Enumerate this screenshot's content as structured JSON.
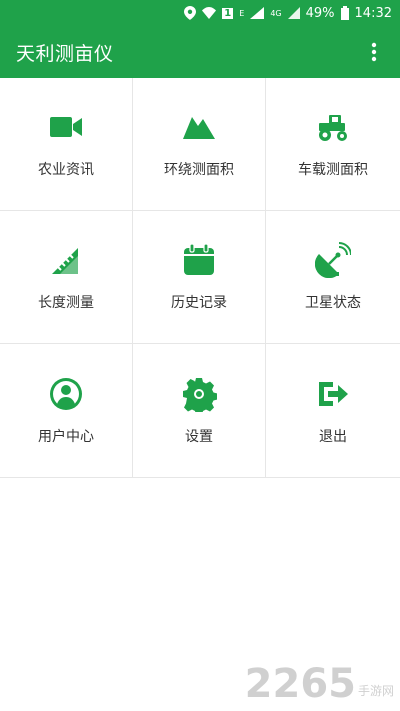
{
  "status_bar": {
    "battery": "49%",
    "time": "14:32",
    "net_label": "E",
    "net_label_2": "4G",
    "sim_badge": "1"
  },
  "app_bar": {
    "title": "天利测亩仪",
    "menu_icon": "more-vert-icon"
  },
  "colors": {
    "brand": "#1fa24a",
    "icon": "#1fa24a"
  },
  "menu": [
    {
      "label": "农业资讯",
      "icon": "video-camera-icon"
    },
    {
      "label": "环绕测面积",
      "icon": "mountain-icon"
    },
    {
      "label": "车载测面积",
      "icon": "tractor-icon"
    },
    {
      "label": "长度测量",
      "icon": "ruler-icon"
    },
    {
      "label": "历史记录",
      "icon": "calendar-icon"
    },
    {
      "label": "卫星状态",
      "icon": "satellite-dish-icon"
    },
    {
      "label": "用户中心",
      "icon": "user-circle-icon"
    },
    {
      "label": "设置",
      "icon": "gear-icon"
    },
    {
      "label": "退出",
      "icon": "exit-icon"
    }
  ],
  "watermark": {
    "number": "2265",
    "suffix": "手游网"
  }
}
